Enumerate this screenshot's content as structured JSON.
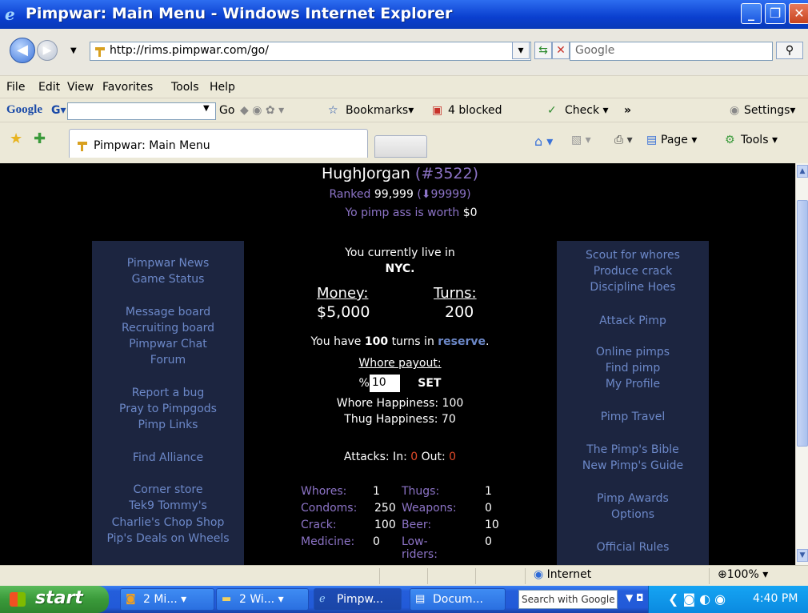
{
  "window": {
    "title": "Pimpwar: Main Menu - Windows Internet Explorer"
  },
  "address_bar": {
    "url": "http://rims.pimpwar.com/go/",
    "search_placeholder": "Google"
  },
  "menu": [
    "File",
    "Edit",
    "View",
    "Favorites",
    "Tools",
    "Help"
  ],
  "google_toolbar": {
    "logo": "Google",
    "go_label": "Go",
    "bookmarks_label": "Bookmarks",
    "blocked_label": "4 blocked",
    "check_label": "Check",
    "more_label": "»",
    "settings_label": "Settings"
  },
  "tabs": {
    "active_label": "Pimpwar: Main Menu",
    "page_label": "Page",
    "tools_label": "Tools"
  },
  "player": {
    "name": "HughJorgan",
    "id_prefix": "(#",
    "id": "3522",
    "id_suffix": ")",
    "ranked_label": "Ranked",
    "rank": "99,999",
    "rank_change": "99999",
    "worth_label": "Yo pimp ass is worth",
    "worth": "$0"
  },
  "status": {
    "live_label": "You currently live in",
    "city": "NYC",
    "money_label": "Money:",
    "money": "$5,000",
    "turns_label": "Turns:",
    "turns": "200",
    "reserve_pre": "You have",
    "reserve_turns": "100",
    "reserve_mid": "turns in",
    "reserve_link": "reserve",
    "payout_label": "Whore payout:",
    "payout_prefix": "%",
    "payout_value": "10",
    "set_label": "SET",
    "whore_happiness": "Whore Happiness: 100",
    "thug_happiness": "Thug Happiness: 70",
    "attacks_label": "Attacks: In:",
    "attacks_in": "0",
    "attacks_out_label": "Out:",
    "attacks_out": "0"
  },
  "inventory": [
    {
      "label": "Whores:",
      "value": "1",
      "label2": "Thugs:",
      "value2": "1"
    },
    {
      "label": "Condoms:",
      "value": "250",
      "label2": "Weapons:",
      "value2": "0"
    },
    {
      "label": "Crack:",
      "value": "100",
      "label2": "Beer:",
      "value2": "10"
    },
    {
      "label": "Medicine:",
      "value": "0",
      "label2": "Low-riders:",
      "value2": "0"
    }
  ],
  "left_links": [
    "Pimpwar News",
    "Game Status",
    "Message board",
    "Recruiting board",
    "Pimpwar Chat",
    "Forum",
    "Report a bug",
    "Pray to Pimpgods",
    "Pimp Links",
    "Find Alliance",
    "Corner store",
    "Tek9 Tommy's",
    "Charlie's Chop Shop",
    "Pip's Deals on Wheels"
  ],
  "right_links": [
    "Scout for whores",
    "Produce crack",
    "Discipline Hoes",
    "Attack Pimp",
    "Online pimps",
    "Find pimp",
    "My Profile",
    "Pimp Travel",
    "The Pimp's Bible",
    "New Pimp's Guide",
    "Pimp Awards",
    "Options",
    "Official Rules"
  ],
  "statusbar": {
    "zone": "Internet",
    "zoom": "100%"
  },
  "taskbar": {
    "start": "start",
    "tasks": [
      "2 Mi...",
      "2 Wi...",
      "Pimpw...",
      "Docum..."
    ],
    "search_placeholder": "Search with Google",
    "clock": "4:40 PM"
  },
  "colors": {
    "link_blue": "#6c88c8",
    "purple": "#8c73c6",
    "red": "#e34b2a",
    "panel": "#1c2540"
  }
}
